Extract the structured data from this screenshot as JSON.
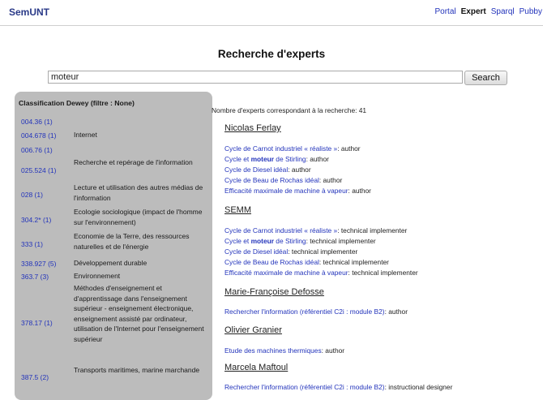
{
  "header": {
    "logo": "SemUNT",
    "nav": [
      "Portal",
      "Expert",
      "Sparql",
      "Pubby"
    ]
  },
  "page": {
    "title": "Recherche d'experts"
  },
  "search": {
    "value": "moteur",
    "button_label": "Search"
  },
  "sidebar": {
    "title": "Classification Dewey (filtre : None)",
    "items": [
      {
        "code": "004.36 (1)",
        "label": ""
      },
      {
        "code": "004.678 (1)",
        "label": "Internet"
      },
      {
        "code": "006.76 (1)",
        "label": ""
      },
      {
        "code": "025.524 (1)",
        "label": "Recherche et repérage de l'information"
      },
      {
        "code": "028 (1)",
        "label": "Lecture et utilisation des autres médias de l'information"
      },
      {
        "code": "304.2* (1)",
        "label": "Ecologie sociologique (impact de l'homme sur l'environnement)"
      },
      {
        "code": "333 (1)",
        "label": "Economie de la Terre, des ressources naturelles et de l'énergie"
      },
      {
        "code": "338.927 (5)",
        "label": "Développement durable"
      },
      {
        "code": "363.7 (3)",
        "label": "Environnement"
      },
      {
        "code": "378.17 (1)",
        "label": "Méthodes d'enseignement et d'apprentissage dans l'enseignement supérieur - enseignement électronique, enseignement assisté par ordinateur, utilisation de l'Internet pour l'enseignement supérieur"
      },
      {
        "code": "387.5 (2)",
        "label": "Transports maritimes, marine marchande"
      }
    ]
  },
  "results": {
    "count_text": "Nombre d'experts correspondant à la recherche: 41",
    "experts": [
      {
        "name": "Nicolas Ferlay",
        "entries": [
          {
            "pre": "Cycle de Carnot industriel « réaliste »",
            "bold": "",
            "post": "",
            "role": ": author"
          },
          {
            "pre": "Cycle et ",
            "bold": "moteur",
            "post": " de Stirling",
            "role": ": author"
          },
          {
            "pre": "Cycle de Diesel idéal",
            "bold": "",
            "post": "",
            "role": ": author"
          },
          {
            "pre": "Cycle de Beau de Rochas idéal",
            "bold": "",
            "post": "",
            "role": ": author"
          },
          {
            "pre": "Efficacité maximale de machine à vapeur",
            "bold": "",
            "post": "",
            "role": ": author"
          }
        ]
      },
      {
        "name": "SEMM",
        "entries": [
          {
            "pre": "Cycle de Carnot industriel « réaliste »",
            "bold": "",
            "post": "",
            "role": ": technical implementer"
          },
          {
            "pre": "Cycle et ",
            "bold": "moteur",
            "post": " de Stirling",
            "role": ": technical implementer"
          },
          {
            "pre": "Cycle de Diesel idéal",
            "bold": "",
            "post": "",
            "role": ": technical implementer"
          },
          {
            "pre": "Cycle de Beau de Rochas idéal",
            "bold": "",
            "post": "",
            "role": ": technical implementer"
          },
          {
            "pre": "Efficacité maximale de machine à vapeur",
            "bold": "",
            "post": "",
            "role": ": technical implementer"
          }
        ]
      },
      {
        "name": "Marie-Françoise Defosse",
        "entries": [
          {
            "pre": "Rechercher l'information (référentiel C2i : module B2)",
            "bold": "",
            "post": "",
            "role": ": author"
          }
        ]
      },
      {
        "name": "Olivier Granier",
        "entries": [
          {
            "pre": "Etude des machines thermiques",
            "bold": "",
            "post": "",
            "role": ": author"
          }
        ]
      },
      {
        "name": "Marcela Maftoul",
        "entries": [
          {
            "pre": "Rechercher l'information (référentiel C2i : module B2)",
            "bold": "",
            "post": "",
            "role": ": instructional designer"
          }
        ]
      }
    ]
  }
}
